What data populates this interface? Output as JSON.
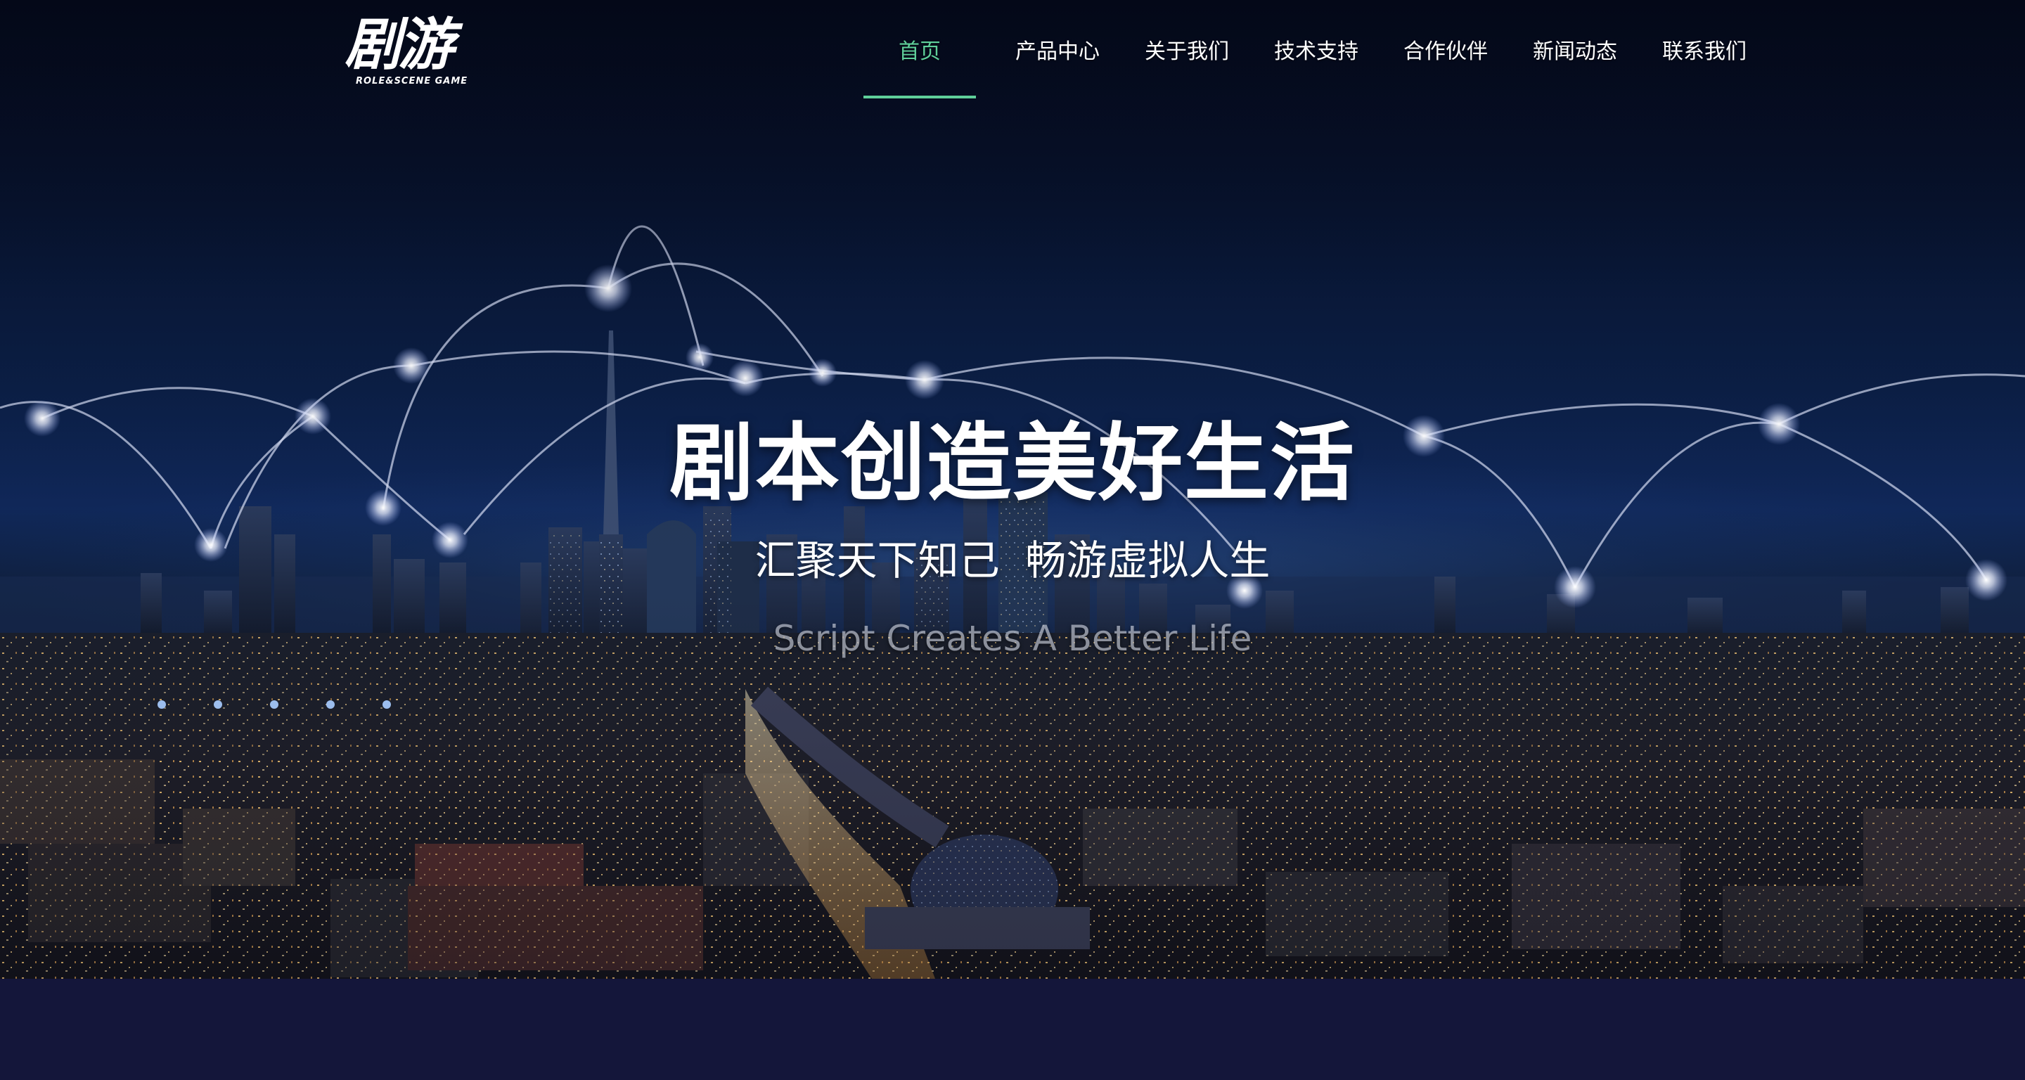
{
  "brand": {
    "logo_text": "剧游",
    "logo_subtitle": "ROLE&SCENE GAME"
  },
  "nav": {
    "items": [
      {
        "label": "首页",
        "active": true
      },
      {
        "label": "产品中心",
        "active": false
      },
      {
        "label": "关于我们",
        "active": false
      },
      {
        "label": "技术支持",
        "active": false
      },
      {
        "label": "合作伙伴",
        "active": false
      },
      {
        "label": "新闻动态",
        "active": false
      },
      {
        "label": "联系我们",
        "active": false
      }
    ]
  },
  "hero": {
    "headline": "剧本创造美好生活",
    "subline": "汇聚天下知己  畅游虚拟人生",
    "english": "Script Creates A Better Life"
  },
  "colors": {
    "accent": "#5fcf9a",
    "nav_text": "#ffffff",
    "band_background": "#14163a",
    "sky_top": "#050b1d"
  }
}
